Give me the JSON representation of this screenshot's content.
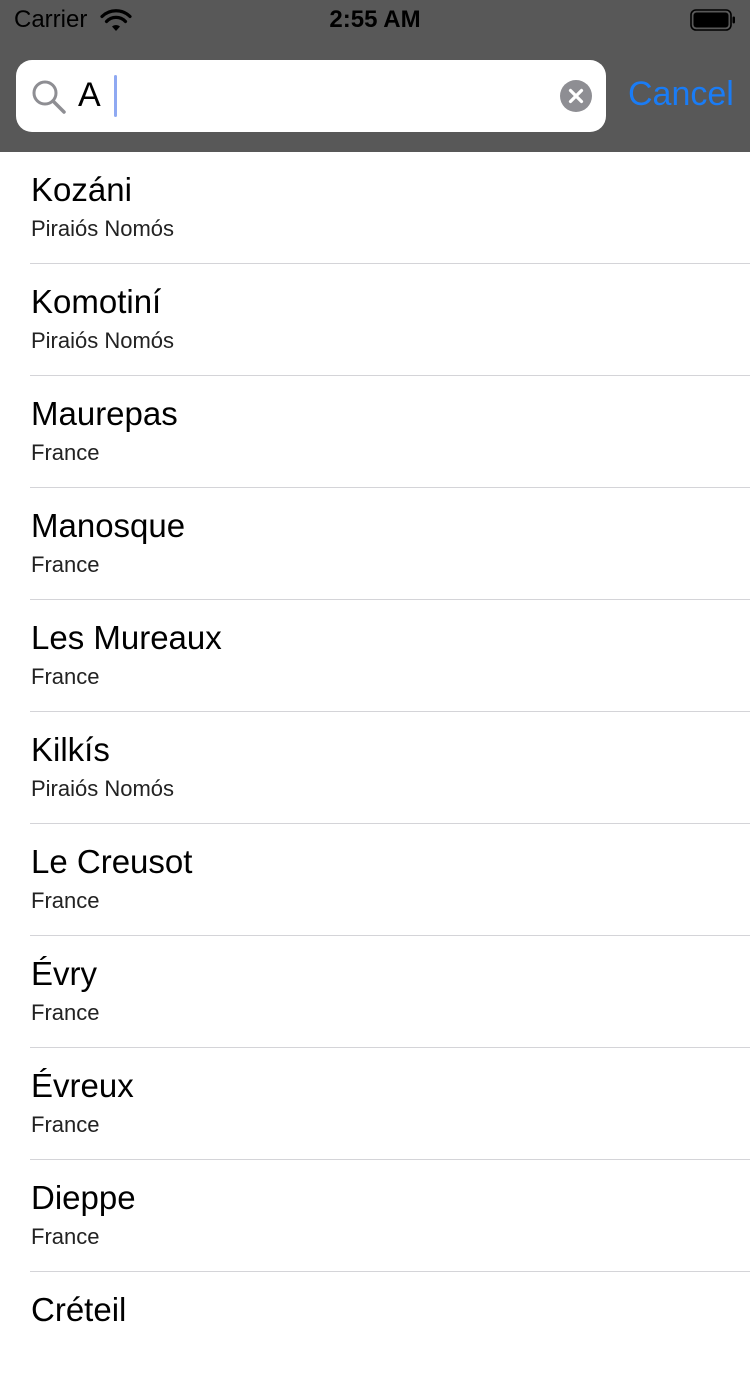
{
  "status_bar": {
    "carrier": "Carrier",
    "time": "2:55 AM"
  },
  "search": {
    "query": "A",
    "cancel_label": "Cancel",
    "icons": {
      "search": "magnifying-glass",
      "clear": "x-circle"
    }
  },
  "colors": {
    "header_bg": "#585858",
    "accent": "#1a7cf5"
  },
  "results": [
    {
      "city": "Kozáni",
      "region": "Piraiós Nomós"
    },
    {
      "city": "Komotiní",
      "region": "Piraiós Nomós"
    },
    {
      "city": "Maurepas",
      "region": "France"
    },
    {
      "city": "Manosque",
      "region": "France"
    },
    {
      "city": "Les Mureaux",
      "region": "France"
    },
    {
      "city": "Kilkís",
      "region": "Piraiós Nomós"
    },
    {
      "city": "Le Creusot",
      "region": "France"
    },
    {
      "city": "Évry",
      "region": "France"
    },
    {
      "city": "Évreux",
      "region": "France"
    },
    {
      "city": "Dieppe",
      "region": "France"
    },
    {
      "city": "Créteil",
      "region": ""
    }
  ]
}
